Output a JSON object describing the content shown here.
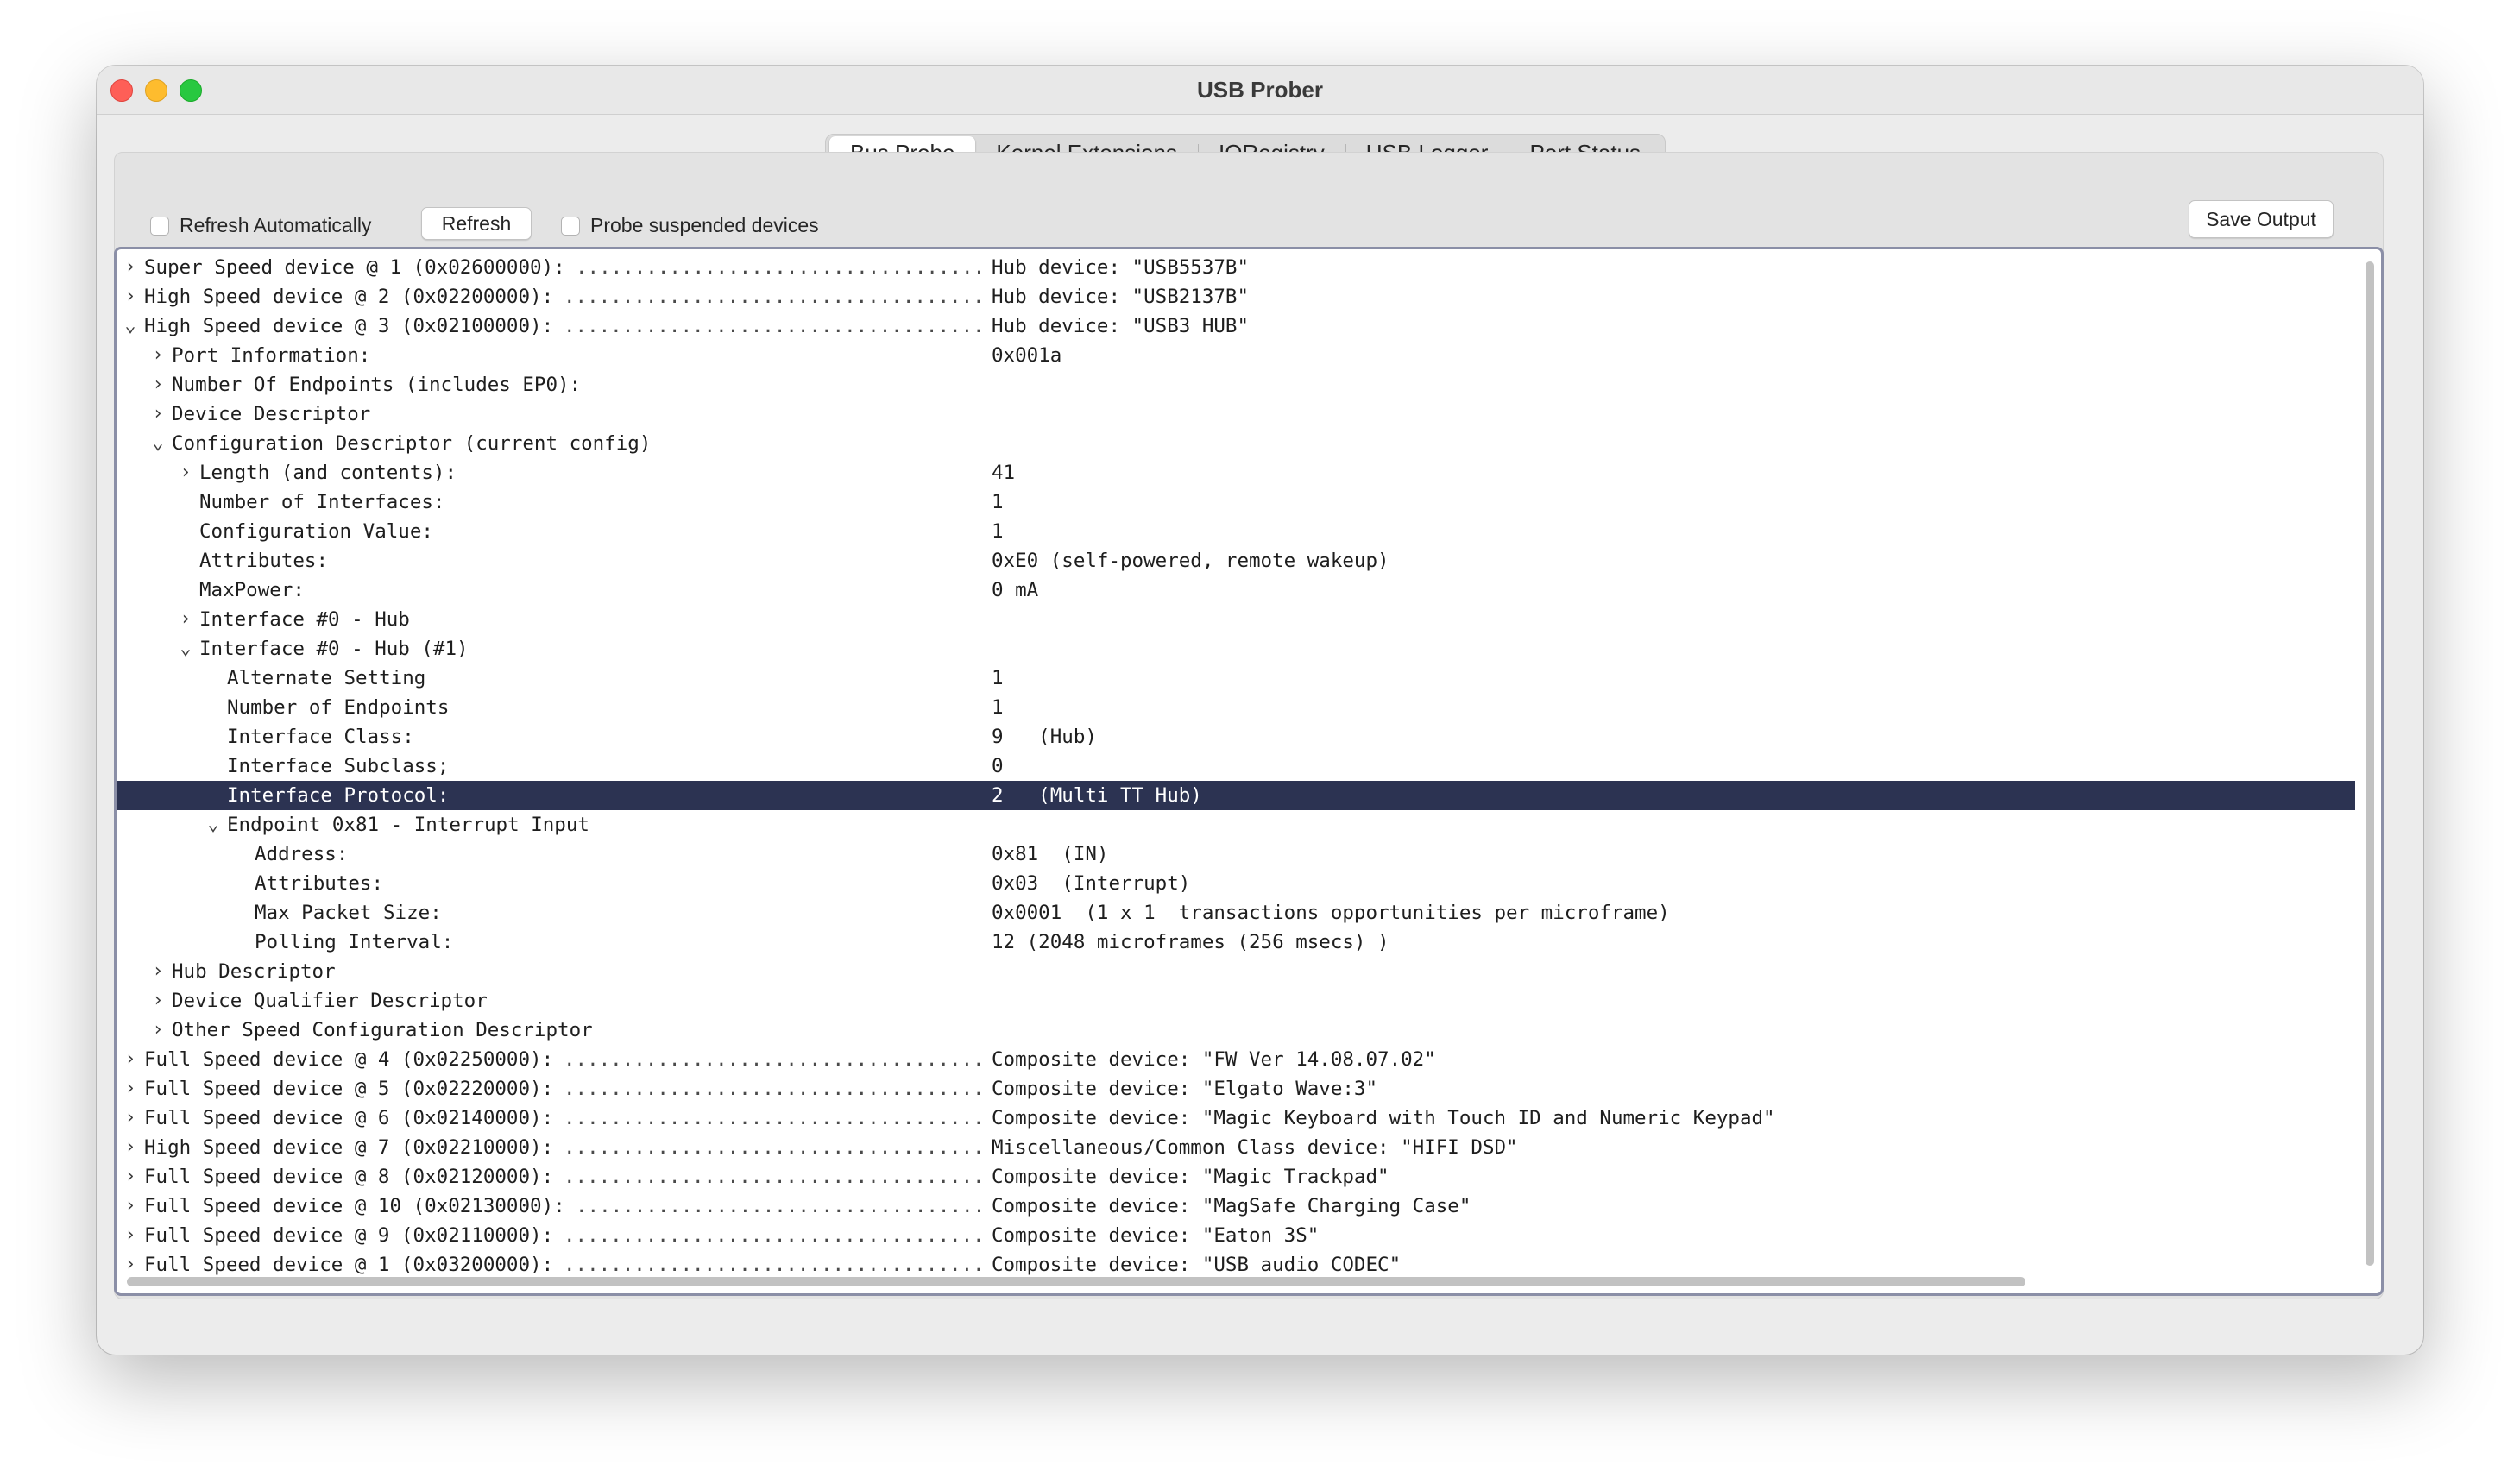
{
  "window": {
    "title": "USB Prober"
  },
  "tabs": [
    "Bus Probe",
    "Kernel Extensions",
    "IORegistry",
    "USB Logger",
    "Port Status"
  ],
  "active_tab": "Bus Probe",
  "toolbar": {
    "refresh_auto_label": "Refresh Automatically",
    "refresh_label": "Refresh",
    "probe_suspended_label": "Probe suspended devices",
    "save_output_label": "Save Output"
  },
  "tree_rows": [
    {
      "depth": 0,
      "disc": "›",
      "label": "Super Speed device @ 1 (0x02600000):",
      "dots": true,
      "value": "Hub device: \"USB5537B\""
    },
    {
      "depth": 0,
      "disc": "›",
      "label": "High Speed device @ 2 (0x02200000):",
      "dots": true,
      "value": "Hub device: \"USB2137B\""
    },
    {
      "depth": 0,
      "disc": "⌄",
      "label": "High Speed device @ 3 (0x02100000):",
      "dots": true,
      "value": "Hub device: \"USB3 HUB\""
    },
    {
      "depth": 1,
      "disc": "›",
      "label": "Port Information:",
      "value": "0x001a"
    },
    {
      "depth": 1,
      "disc": "›",
      "label": "Number Of Endpoints (includes EP0):",
      "value": ""
    },
    {
      "depth": 1,
      "disc": "›",
      "label": "Device Descriptor",
      "value": ""
    },
    {
      "depth": 1,
      "disc": "⌄",
      "label": "Configuration Descriptor (current config)",
      "value": ""
    },
    {
      "depth": 2,
      "disc": "›",
      "label": "Length (and contents):",
      "value": "41"
    },
    {
      "depth": 2,
      "disc": "",
      "label": "Number of Interfaces:",
      "value": "1"
    },
    {
      "depth": 2,
      "disc": "",
      "label": "Configuration Value:",
      "value": "1"
    },
    {
      "depth": 2,
      "disc": "",
      "label": "Attributes:",
      "value": "0xE0 (self-powered, remote wakeup)"
    },
    {
      "depth": 2,
      "disc": "",
      "label": "MaxPower:",
      "value": "0 mA"
    },
    {
      "depth": 2,
      "disc": "›",
      "label": "Interface #0 - Hub",
      "value": ""
    },
    {
      "depth": 2,
      "disc": "⌄",
      "label": "Interface #0 - Hub (#1)",
      "value": ""
    },
    {
      "depth": 3,
      "disc": "",
      "label": "Alternate Setting",
      "value": "1"
    },
    {
      "depth": 3,
      "disc": "",
      "label": "Number of Endpoints",
      "value": "1"
    },
    {
      "depth": 3,
      "disc": "",
      "label": "Interface Class:",
      "value": "9   (Hub)"
    },
    {
      "depth": 3,
      "disc": "",
      "label": "Interface Subclass;",
      "value": "0"
    },
    {
      "depth": 3,
      "disc": "",
      "label": "Interface Protocol:",
      "value": "2   (Multi TT Hub)",
      "selected": true
    },
    {
      "depth": 3,
      "disc": "⌄",
      "label": "Endpoint 0x81 - Interrupt Input",
      "value": ""
    },
    {
      "depth": 4,
      "disc": "",
      "label": "Address:",
      "value": "0x81  (IN)"
    },
    {
      "depth": 4,
      "disc": "",
      "label": "Attributes:",
      "value": "0x03  (Interrupt)"
    },
    {
      "depth": 4,
      "disc": "",
      "label": "Max Packet Size:",
      "value": "0x0001  (1 x 1  transactions opportunities per microframe)"
    },
    {
      "depth": 4,
      "disc": "",
      "label": "Polling Interval:",
      "value": "12 (2048 microframes (256 msecs) )"
    },
    {
      "depth": 1,
      "disc": "›",
      "label": "Hub Descriptor",
      "value": ""
    },
    {
      "depth": 1,
      "disc": "›",
      "label": "Device Qualifier Descriptor",
      "value": ""
    },
    {
      "depth": 1,
      "disc": "›",
      "label": "Other Speed Configuration Descriptor",
      "value": ""
    },
    {
      "depth": 0,
      "disc": "›",
      "label": "Full Speed device @ 4 (0x02250000):",
      "dots": true,
      "value": "Composite device: \"FW Ver 14.08.07.02\""
    },
    {
      "depth": 0,
      "disc": "›",
      "label": "Full Speed device @ 5 (0x02220000):",
      "dots": true,
      "value": "Composite device: \"Elgato Wave:3\""
    },
    {
      "depth": 0,
      "disc": "›",
      "label": "Full Speed device @ 6 (0x02140000):",
      "dots": true,
      "value": "Composite device: \"Magic Keyboard with Touch ID and Numeric Keypad\""
    },
    {
      "depth": 0,
      "disc": "›",
      "label": "High Speed device @ 7 (0x02210000):",
      "dots": true,
      "value": "Miscellaneous/Common Class device: \"HIFI DSD\""
    },
    {
      "depth": 0,
      "disc": "›",
      "label": "Full Speed device @ 8 (0x02120000):",
      "dots": true,
      "value": "Composite device: \"Magic Trackpad\""
    },
    {
      "depth": 0,
      "disc": "›",
      "label": "Full Speed device @ 10 (0x02130000):",
      "dots": true,
      "value": "Composite device: \"MagSafe Charging Case\""
    },
    {
      "depth": 0,
      "disc": "›",
      "label": "Full Speed device @ 9 (0x02110000):",
      "dots": true,
      "value": "Composite device: \"Eaton 3S\""
    },
    {
      "depth": 0,
      "disc": "›",
      "label": "Full Speed device @ 1 (0x03200000):",
      "dots": true,
      "value": "Composite device: \"USB audio CODEC\""
    }
  ],
  "dots_text": "....................................",
  "colors": {
    "selection": "#2c3352",
    "outline_border": "#8b8fa7"
  }
}
